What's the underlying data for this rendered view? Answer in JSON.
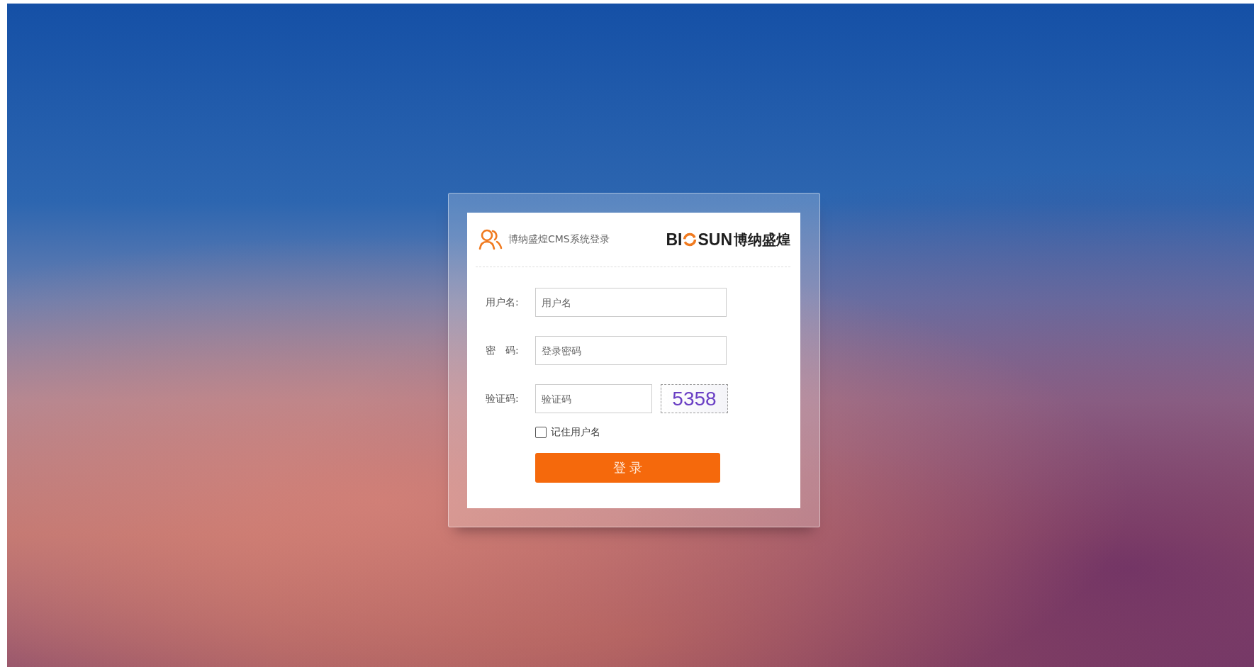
{
  "header": {
    "title": "博纳盛煌CMS系统登录",
    "logo": {
      "left": "BI",
      "right": "SUN",
      "cn": "博纳盛煌"
    }
  },
  "fields": [
    {
      "kind": "text",
      "label": "用户名:",
      "placeholder": "用户名"
    },
    {
      "kind": "password",
      "label": "密　码:",
      "placeholder": "登录密码"
    },
    {
      "kind": "captcha",
      "label": "验证码:",
      "placeholder": "验证码",
      "code": "5358"
    }
  ],
  "remember": {
    "label": "记住用户名",
    "checked": false
  },
  "button": "登 录"
}
